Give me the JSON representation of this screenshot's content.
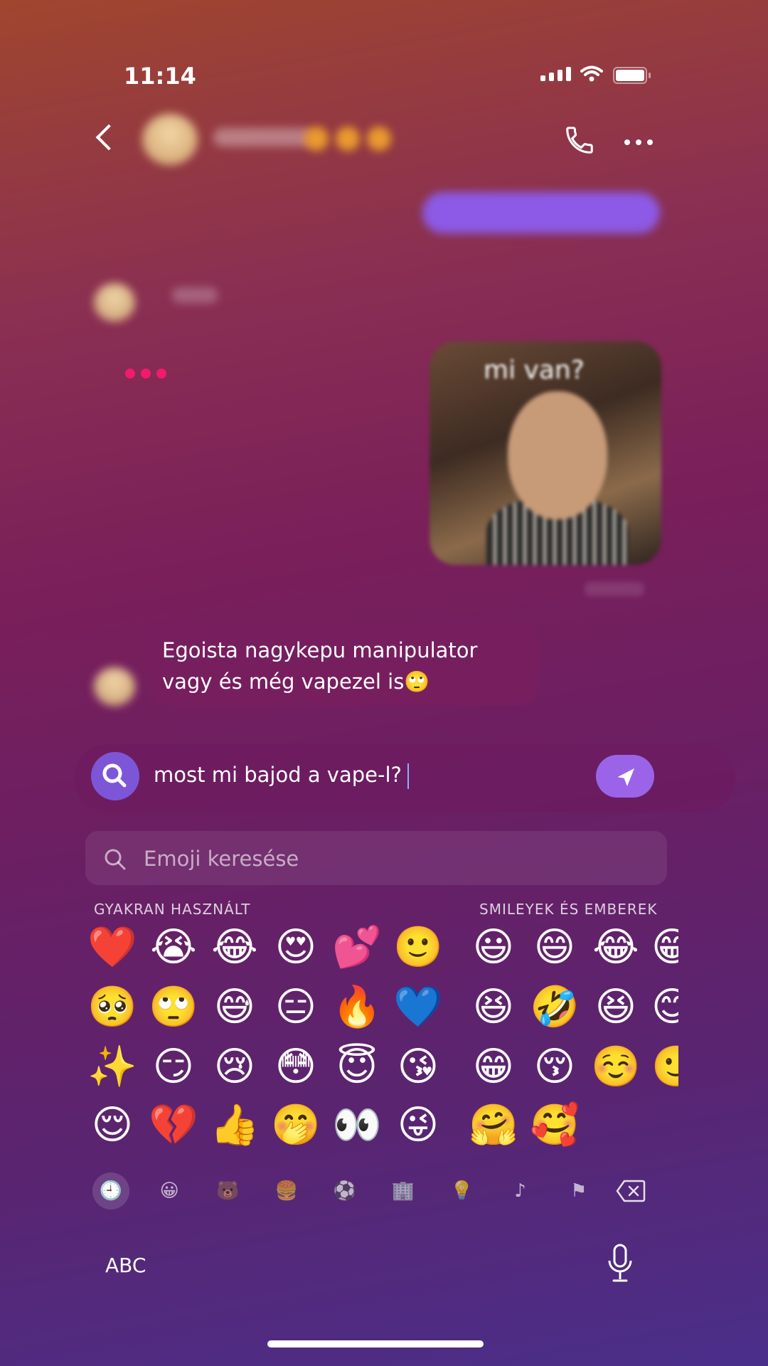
{
  "status": {
    "time": "11:14"
  },
  "conversation": {
    "typing_indicator_color": "#f21a6b",
    "photo_caption": "mi van?",
    "incoming_message": "Egoista nagykepu manipulator vagy és még vapezel is🙄"
  },
  "composer": {
    "text": "most mi bajod a vape-l?"
  },
  "emoji_keyboard": {
    "search_placeholder": "Emoji keresése",
    "section_frequent": "GYAKRAN HASZNÁLT",
    "section_smileys": "SMILEYEK ÉS EMBEREK",
    "frequent": [
      [
        "❤️",
        "😭",
        "😂",
        "😍",
        "💕",
        "🙂"
      ],
      [
        "🥺",
        "🙄",
        "😅",
        "😑",
        "🔥",
        "💙"
      ],
      [
        "✨",
        "😏",
        "😢",
        "😳",
        "😇",
        "😘"
      ],
      [
        "😌",
        "💔",
        "👍",
        "🤭",
        "👀",
        "😜"
      ]
    ],
    "smileys": [
      [
        "😃",
        "😄",
        "😂",
        "😁"
      ],
      [
        "😆",
        "🤣",
        "😆",
        "😊"
      ],
      [
        "😁",
        "😚",
        "☺️",
        "🙂"
      ],
      [
        "🤗",
        "🥰"
      ]
    ],
    "categories": [
      "recent-icon",
      "smiley-icon",
      "animal-icon",
      "food-icon",
      "activity-icon",
      "travel-icon",
      "objects-icon",
      "symbols-icon",
      "flags-icon"
    ],
    "category_glyphs": [
      "🕘",
      "😀",
      "🐻",
      "🍔",
      "⚽",
      "🏢",
      "💡",
      "♪",
      "⚑"
    ],
    "abc_label": "ABC"
  }
}
